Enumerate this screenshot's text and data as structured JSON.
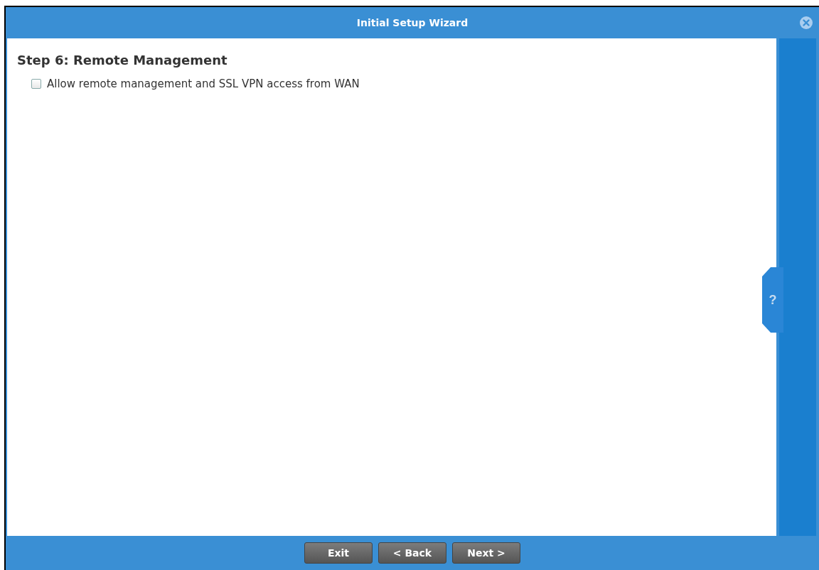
{
  "window": {
    "title": "Initial Setup Wizard"
  },
  "step": {
    "title": "Step 6: Remote Management"
  },
  "options": [
    {
      "label": "Allow remote management and SSL VPN access from WAN",
      "checked": false
    }
  ],
  "help": {
    "label": "?"
  },
  "buttons": [
    {
      "label": "Exit"
    },
    {
      "label": "< Back"
    },
    {
      "label": "Next >"
    }
  ]
}
